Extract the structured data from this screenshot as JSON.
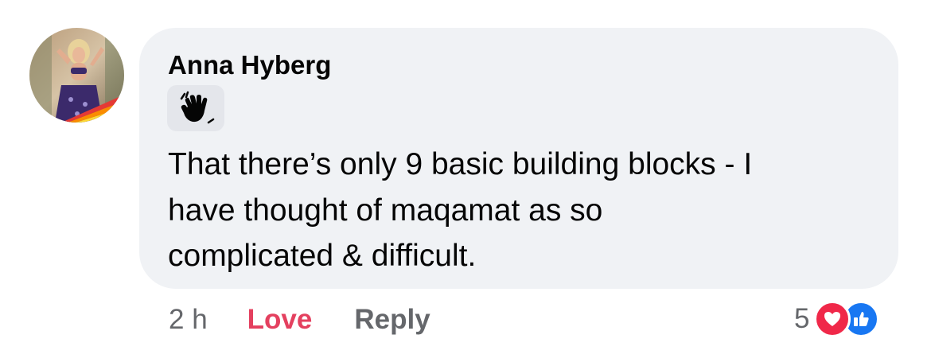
{
  "comment": {
    "author": "Anna Hyberg",
    "badge_icon": "waving-hand-icon",
    "text_lines": [
      "That there’s only 9 basic building blocks - I",
      "have thought of maqamat as so",
      "complicated & difficult."
    ]
  },
  "actions": {
    "time": "2 h",
    "love_label": "Love",
    "reply_label": "Reply"
  },
  "reactions": {
    "count": "5",
    "icons": [
      "heart-icon",
      "like-icon"
    ],
    "colors": {
      "love": "#f02849",
      "like": "#1877f2",
      "love_text": "#e4405f"
    }
  }
}
